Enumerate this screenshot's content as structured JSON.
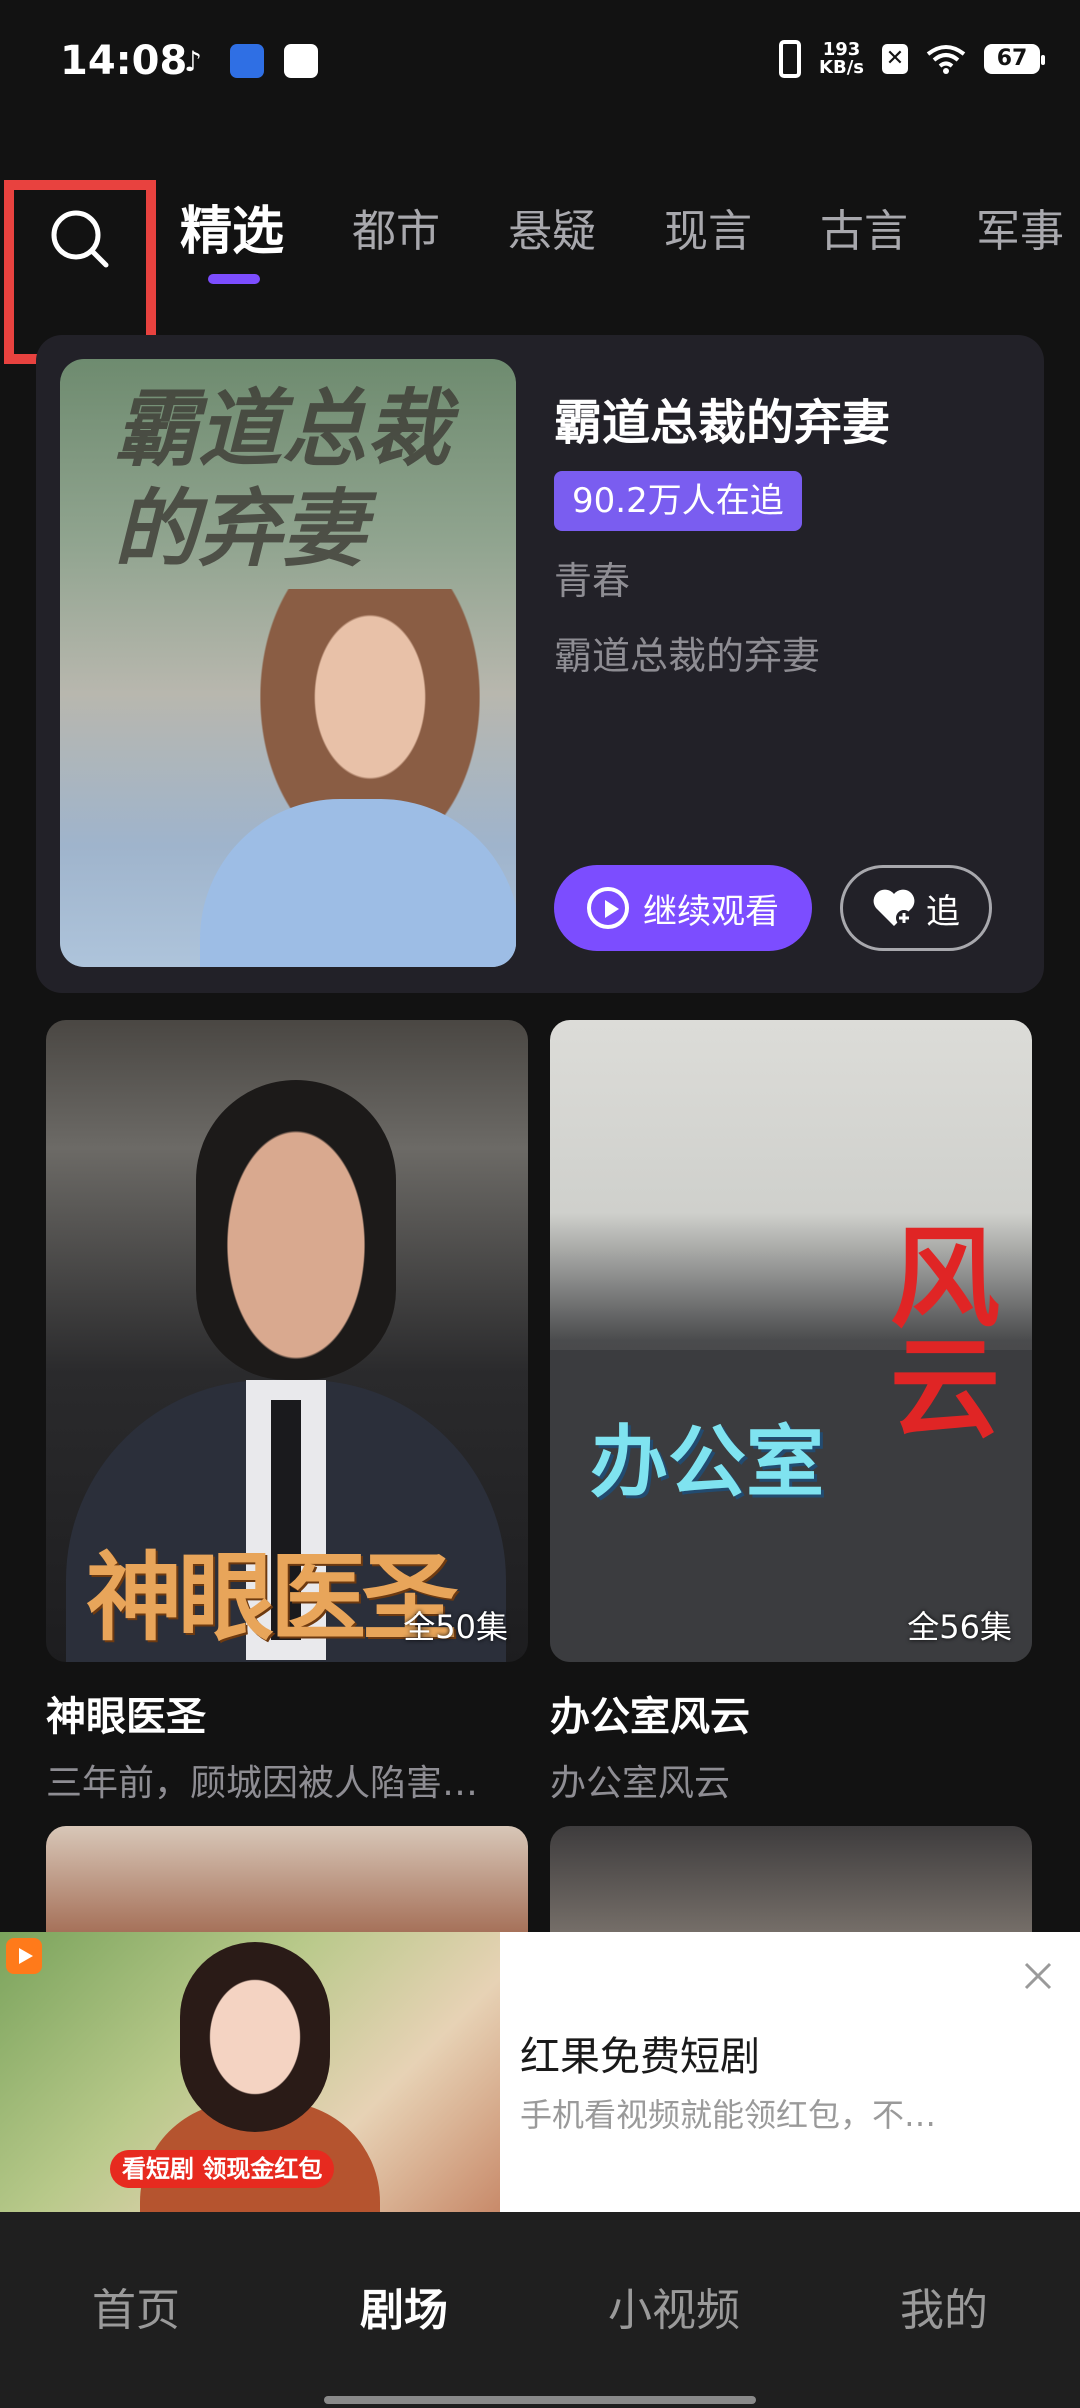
{
  "status_bar": {
    "time": "14:08",
    "net_speed_value": "193",
    "net_speed_unit": "KB/s",
    "battery": "67",
    "icons": [
      "tiktok-icon",
      "browser-app-icon",
      "mail-app-icon",
      "vibrate-icon",
      "close-box-icon",
      "wifi-icon",
      "battery-icon"
    ]
  },
  "search": {
    "icon": "search-icon"
  },
  "tabs": [
    "精选",
    "都市",
    "悬疑",
    "现言",
    "古言",
    "军事"
  ],
  "active_tab": "精选",
  "featured": {
    "poster_title": "霸道总裁的弃妻",
    "title": "霸道总裁的弃妻",
    "followers": "90.2万人在追",
    "genre": "青春",
    "description": "霸道总裁的弃妻",
    "continue_label": "继续观看",
    "follow_label": "追"
  },
  "cards": [
    {
      "poster_title": "神眼医圣",
      "episodes": "全50集",
      "title": "神眼医圣",
      "description": "三年前，顾城因被人陷害…"
    },
    {
      "poster_title_1": "办公室",
      "poster_title_2": "风云",
      "episodes": "全56集",
      "title": "办公室风云",
      "description": "办公室风云"
    }
  ],
  "ad": {
    "promo": "看短剧 领现金红包",
    "title": "红果免费短剧",
    "description": "手机看视频就能领红包，不…"
  },
  "bottom_nav": [
    "首页",
    "剧场",
    "小视频",
    "我的"
  ],
  "active_nav": "剧场",
  "colors": {
    "accent": "#7c4dff",
    "badge": "#7a5df0",
    "background": "#121212",
    "highlight_box": "#e8423f"
  }
}
